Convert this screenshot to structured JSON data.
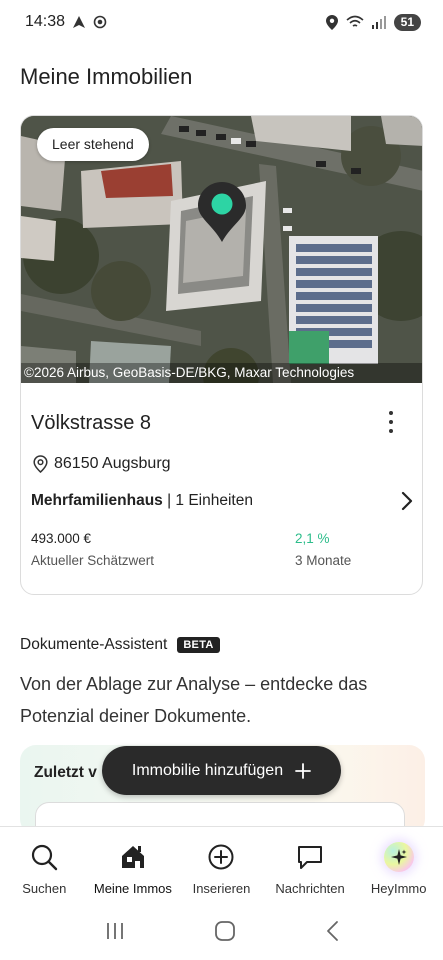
{
  "status_bar": {
    "time": "14:38",
    "battery": "51"
  },
  "page": {
    "title": "Meine Immobilien"
  },
  "property": {
    "status_chip": "Leer stehend",
    "map_credit": "©2026 Airbus, GeoBasis-DE/BKG, Maxar Technologies",
    "title": "Völkstrasse 8",
    "location": "86150 Augsburg",
    "type": "Mehrfamilienhaus",
    "units": "1 Einheiten",
    "estimated_value": "493.000 €",
    "estimated_value_label": "Aktueller Schätzwert",
    "change": "2,1 %",
    "change_period": "3 Monate",
    "colors": {
      "pin_accent": "#2dd4a4",
      "change_positive": "#2dbd8b"
    }
  },
  "documents": {
    "title": "Dokumente-Assistent",
    "badge": "BETA",
    "description": "Von der Ablage zur Analyse – entdecke das Potenzial deiner Dokumente.",
    "recent_label": "Zuletzt v"
  },
  "fab": {
    "label": "Immobilie hinzufügen",
    "icon": "plus-icon"
  },
  "bottom_nav": {
    "items": [
      {
        "label": "Suchen",
        "icon": "search-icon"
      },
      {
        "label": "Meine Immos",
        "icon": "home-icon",
        "active": true
      },
      {
        "label": "Inserieren",
        "icon": "add-circle-icon"
      },
      {
        "label": "Nachrichten",
        "icon": "chat-icon"
      },
      {
        "label": "HeyImmo",
        "icon": "sparkle-icon"
      }
    ]
  }
}
